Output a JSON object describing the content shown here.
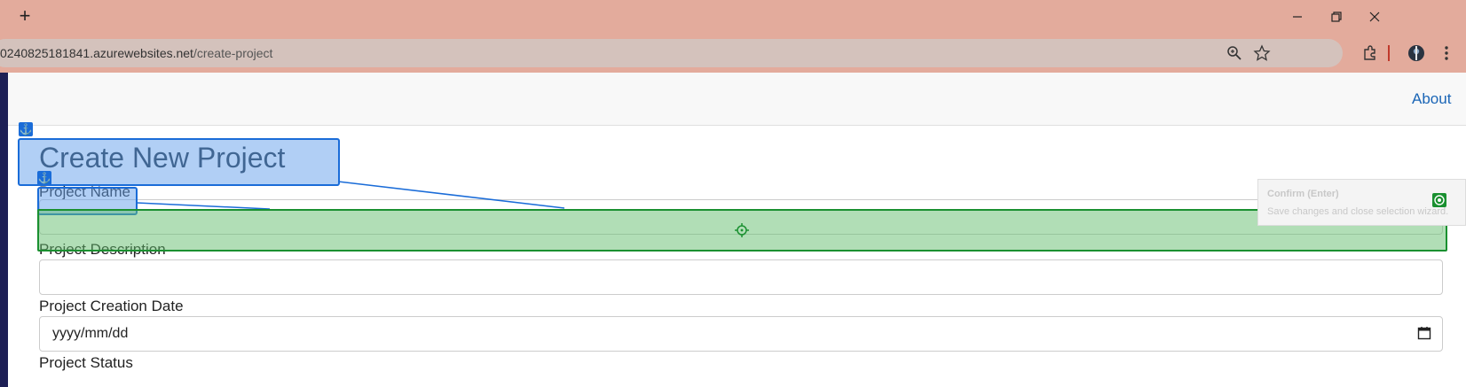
{
  "browser": {
    "new_tab_label": "+",
    "url_host": "0240825181841.azurewebsites.net",
    "url_path": "/create-project"
  },
  "nav": {
    "about": "About"
  },
  "form": {
    "title": "Create New Project",
    "project_name_label": "Project Name",
    "project_description_label": "Project Description",
    "creation_date_label": "Project Creation Date",
    "creation_date_placeholder": "yyyy/mm/dd",
    "status_label": "Project Status"
  },
  "overlay": {
    "confirm_title": "Confirm (Enter)",
    "confirm_desc": "Save changes and close selection wizard."
  }
}
